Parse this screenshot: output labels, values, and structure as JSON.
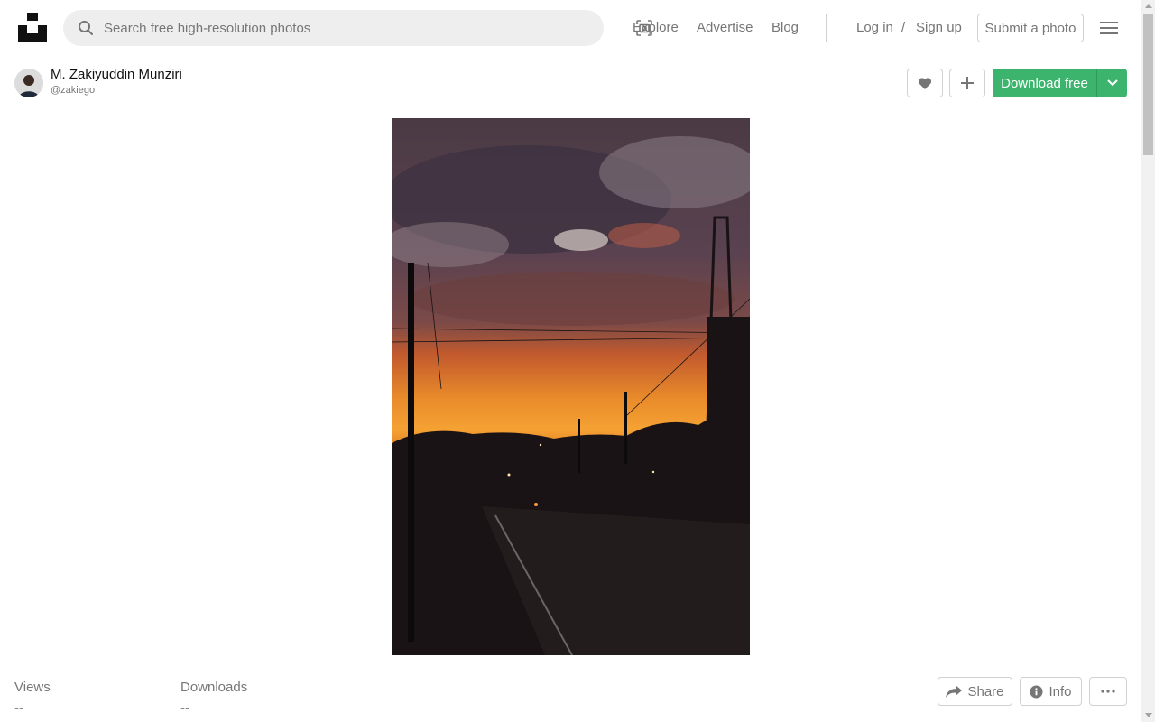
{
  "header": {
    "logo_icon": "unsplash-logo-icon",
    "search": {
      "placeholder": "Search free high-resolution photos",
      "value": "",
      "icon": "search-icon",
      "visual_search_icon": "visual-search-icon"
    },
    "nav": {
      "explore": "Explore",
      "advertise": "Advertise",
      "blog": "Blog",
      "login": "Log in",
      "separator": "/",
      "signup": "Sign up",
      "submit": "Submit a photo"
    },
    "menu_icon": "hamburger-menu-icon"
  },
  "author": {
    "name": "M. Zakiyuddin Munziri",
    "handle": "@zakiego"
  },
  "actions": {
    "like_icon": "heart-icon",
    "collect_icon": "plus-icon",
    "download_label": "Download free",
    "download_caret_icon": "chevron-down-icon",
    "accent_color": "#3cb46e"
  },
  "stats": {
    "views_label": "Views",
    "views_value": "--",
    "downloads_label": "Downloads",
    "downloads_value": "--"
  },
  "footer_actions": {
    "share_label": "Share",
    "share_icon": "share-icon",
    "info_label": "Info",
    "info_icon": "info-icon",
    "more_icon": "more-horizontal-icon"
  }
}
